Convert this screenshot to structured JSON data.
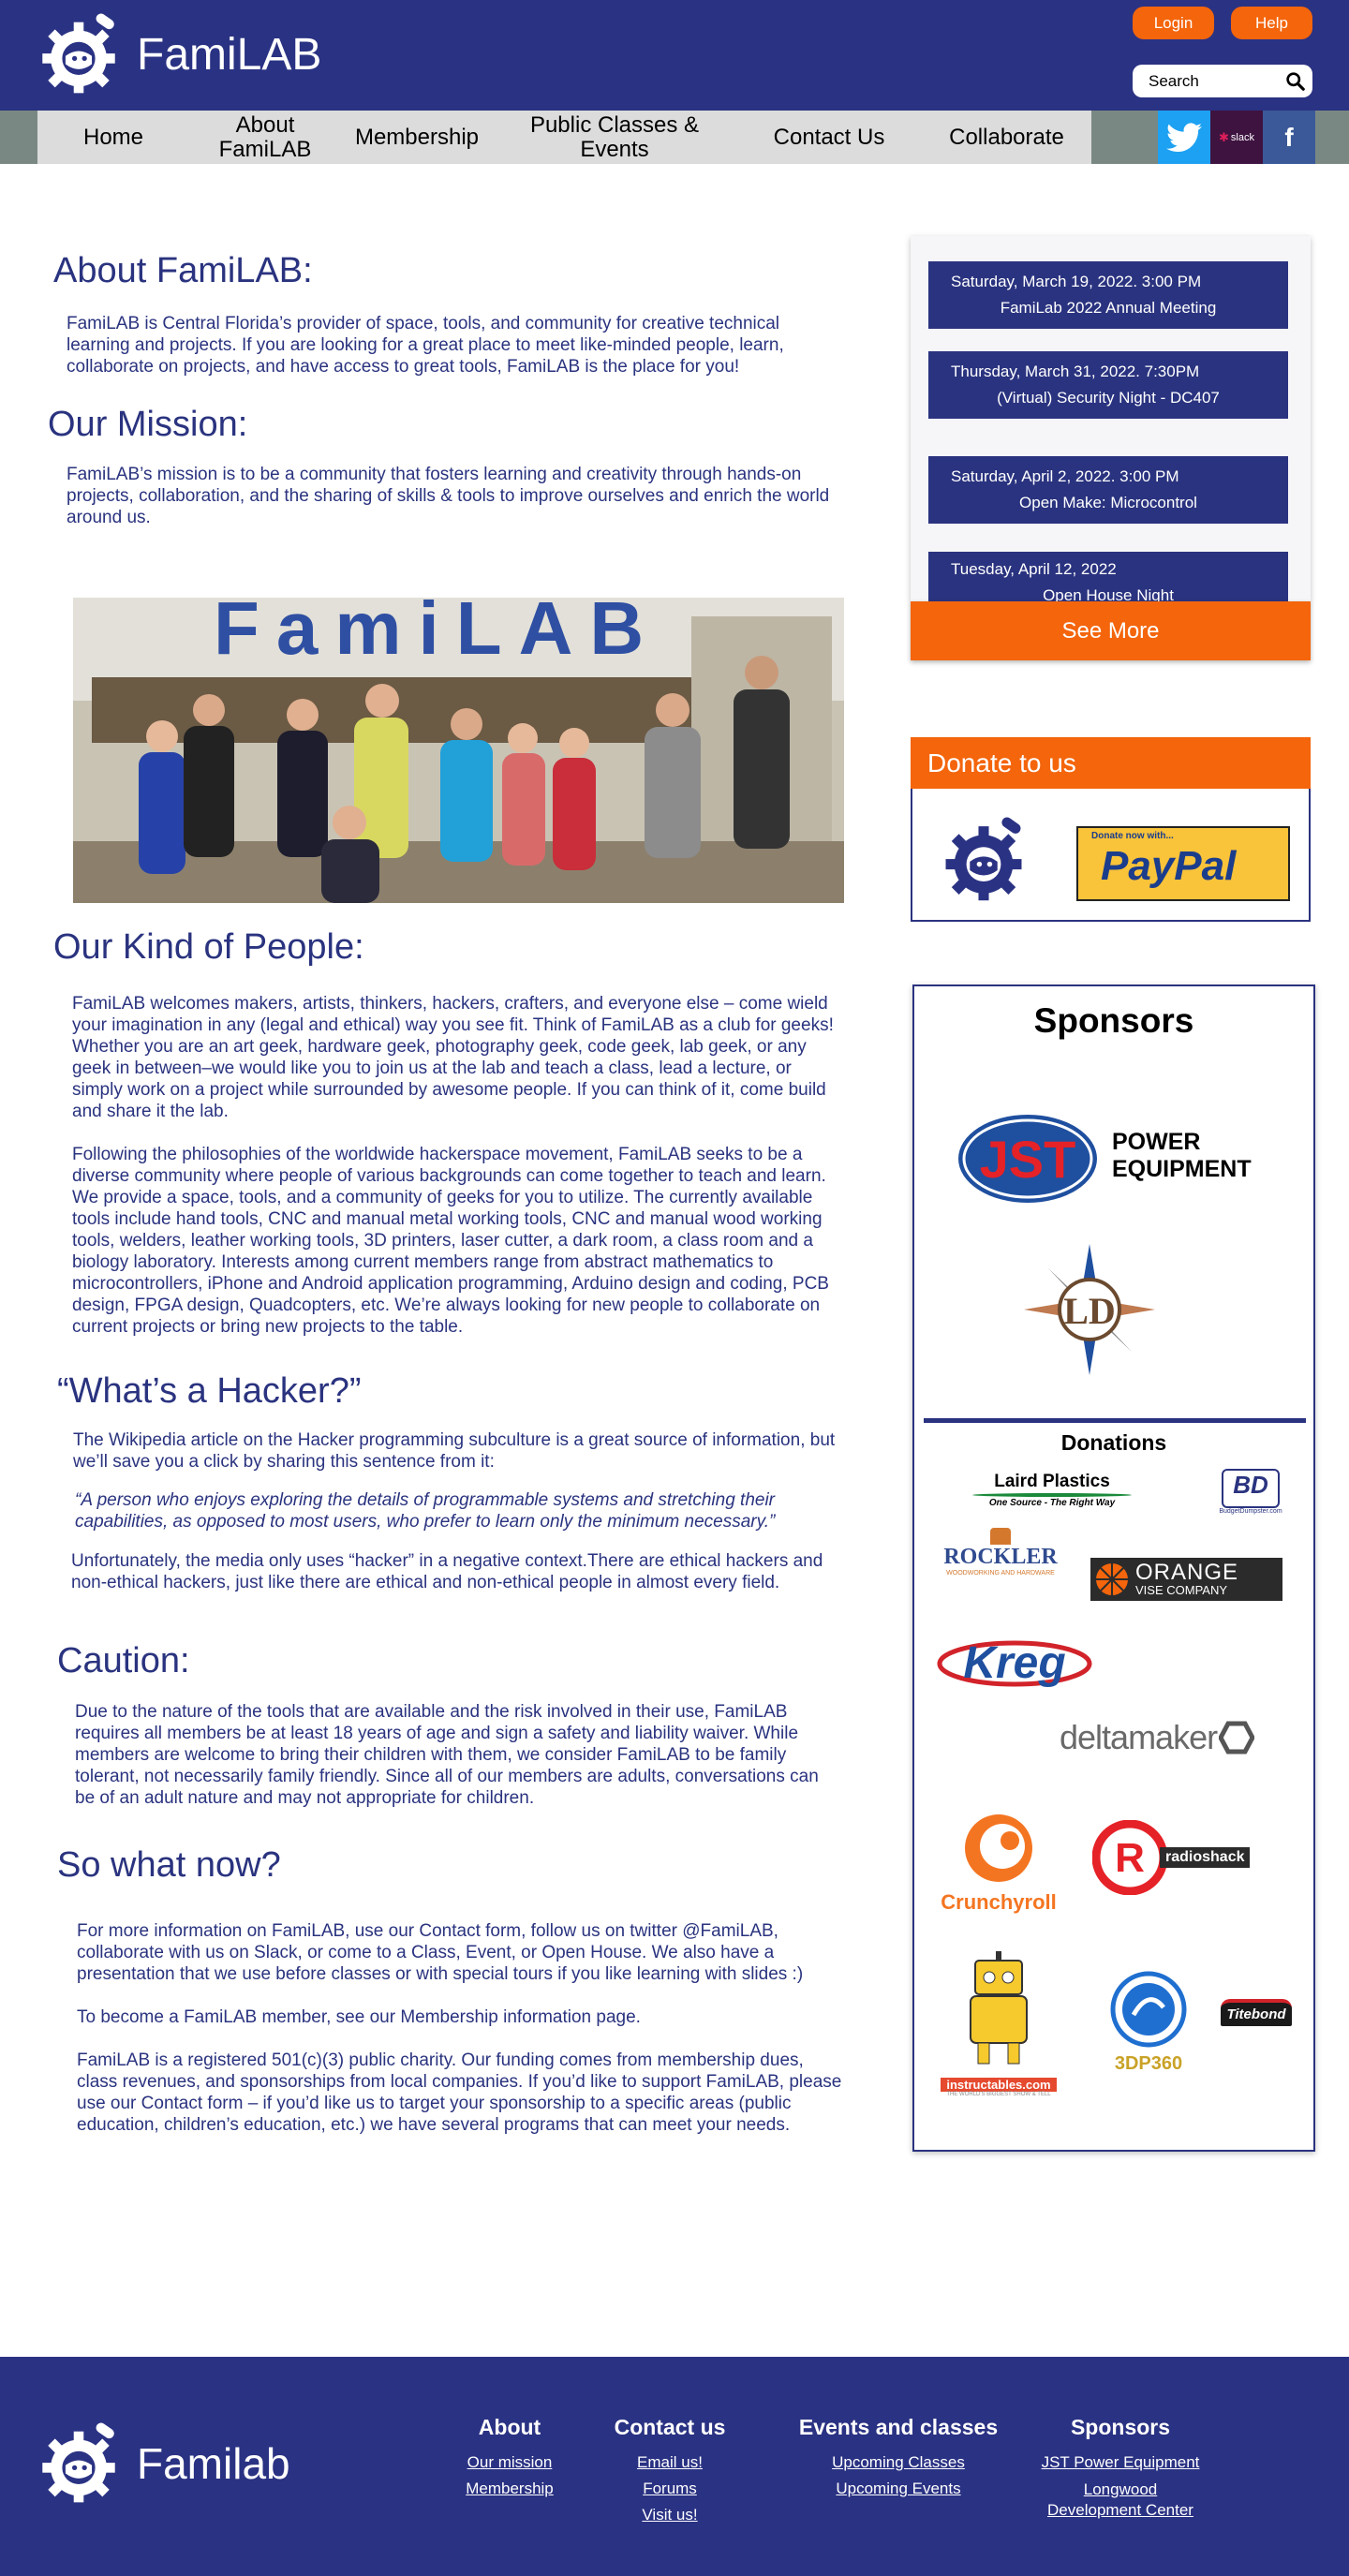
{
  "header": {
    "logo_text": "FamiLAB",
    "login_label": "Login",
    "help_label": "Help",
    "search_placeholder": "Search"
  },
  "nav": {
    "items": [
      "Home",
      "About FamiLAB",
      "Membership",
      "Public Classes & Events",
      "Contact Us",
      "Collaborate"
    ],
    "social": [
      "twitter-icon",
      "slack-icon",
      "facebook-icon"
    ],
    "slack_label": "slack"
  },
  "about": {
    "title": "About FamiLAB:",
    "text": "FamiLAB is Central Florida’s provider of space, tools, and community for creative technical learning and projects. If you are looking for a great place to meet like-minded people, learn, collaborate on projects, and have access to great tools, FamiLAB is the place for you!"
  },
  "mission": {
    "title": "Our Mission:",
    "text": "FamiLAB’s mission is to be a community that fosters learning and creativity through hands-on projects, collaboration, and the sharing of skills & tools to improve ourselves and enrich the world around us."
  },
  "photo": {
    "sign_text": "FamiLAB"
  },
  "people": {
    "title": "Our Kind of People:",
    "p1": "FamiLAB welcomes makers, artists, thinkers, hackers, crafters, and everyone else – come wield your imagination in any (legal and ethical) way you see fit. Think of FamiLAB as a club for geeks!  Whether you are an art geek, hardware geek, photography geek, code geek, lab geek, or any geek in between–we would like you to join us at the lab and teach a class, lead a lecture, or simply work on a project while surrounded by awesome people. If you can think of it, come build and share it the lab.",
    "p2": "Following the philosophies of the worldwide hackerspace movement, FamiLAB seeks to be a diverse community where people of various backgrounds can come together to teach and learn. We provide a space, tools, and a community of geeks for you to utilize. The currently available tools include hand tools, CNC and manual metal working tools, CNC and manual wood working tools, welders, leather working tools, 3D printers, laser cutter, a dark room, a class room and a biology laboratory. Interests among current members range from abstract mathematics to microcontrollers, iPhone and Android application programming, Arduino design and coding, PCB design, FPGA design, Quadcopters, etc.  We’re always looking for new people to collaborate on current projects or bring new projects to the table."
  },
  "hacker": {
    "title": "“What’s a Hacker?”",
    "p1": "The Wikipedia article on the Hacker programming subculture is a great source of information, but we’ll save you a click by sharing this sentence from it:",
    "quote": "“A person who enjoys exploring the details of programmable systems and stretching their capabilities, as opposed to most users, who prefer to learn only the minimum necessary.”",
    "p2": "Unfortunately, the media only uses “hacker” in a negative context.There are ethical hackers and non-ethical hackers, just like there are ethical and non-ethical people in almost every field."
  },
  "caution": {
    "title": "Caution:",
    "text": "Due to the nature of the tools that are available and the risk involved in their use, FamiLAB requires all members be at least 18 years of age and sign a safety and liability waiver. While members are welcome to bring their children with them, we consider FamiLAB to be family tolerant, not necessarily family friendly. Since all of our members are adults, conversations can be of an adult nature and may not appropriate for children."
  },
  "whatnow": {
    "title": "So what now?",
    "p1": "For more information on FamiLAB, use our Contact form, follow us on twitter @FamiLAB, collaborate with us on Slack, or come to a Class, Event, or Open House. We also have a presentation that we use before classes or with special tours if you like learning with slides :)",
    "p2": "To become a FamiLAB member, see our Membership information page.",
    "p3": "FamiLAB is a registered 501(c)(3) public charity. Our funding comes from membership dues, class revenues, and sponsorships from local companies. If you’d like to support FamiLAB, please use our Contact form – if you’d like us to target your sponsorship to a specific areas (public education, children’s education, etc.) we have several programs that can meet your needs."
  },
  "events": [
    {
      "date": "Saturday, March 19, 2022. 3:00 PM",
      "title": "FamiLab 2022 Annual Meeting"
    },
    {
      "date": "Thursday, March 31, 2022. 7:30PM",
      "title": "(Virtual) Security Night - DC407"
    },
    {
      "date": "Saturday, April 2, 2022. 3:00 PM",
      "title": "Open Make: Microcontrol"
    },
    {
      "date": "Tuesday, April 12, 2022",
      "title": "Open House Night"
    }
  ],
  "see_more_label": "See More",
  "donate": {
    "title": "Donate to us",
    "paypal_small": "Donate now with...",
    "paypal_big": "PayPal"
  },
  "sponsors": {
    "title": "Sponsors",
    "jst_letters": "JST",
    "jst_line1": "POWER",
    "jst_line2": "EQUIPMENT",
    "ldc_letters": "LD",
    "donations_title": "Donations",
    "laird_name": "Laird Plastics",
    "laird_tagline": "One Source - The Right Way",
    "bd_letters": "BD",
    "bd_name": "BudgetDumpster.com",
    "rockler_name": "ROCKLER",
    "rockler_tagline": "WOODWORKING AND HARDWARE",
    "orange_line1": "ORANGE",
    "orange_line2": "VISE COMPANY",
    "kreg_name": "Kreg",
    "deltamaker_name": "deltamaker",
    "crunchyroll_name": "Crunchyroll",
    "radioshack_name": "radioshack",
    "instructables_name": "instructables.com",
    "instructables_tagline": "THE WORLD'S BIGGEST SHOW & TELL",
    "threedp_name": "3DP360",
    "titebond_name": "Titebond"
  },
  "footer": {
    "logo_text": "Familab",
    "cols": [
      {
        "heading": "About",
        "links": [
          "Our mission",
          "Membership"
        ]
      },
      {
        "heading": "Contact us",
        "links": [
          "Email us!",
          "Forums",
          "Visit us!"
        ]
      },
      {
        "heading": "Events and classes",
        "links": [
          "Upcoming Classes",
          "Upcoming Events"
        ]
      },
      {
        "heading": "Sponsors",
        "links": [
          "JST Power Equipment",
          "Longwood Development Center"
        ]
      }
    ]
  },
  "colors": {
    "brand_blue": "#2a3283",
    "accent_orange": "#f4650c",
    "nav_gray": "#dcdcdc"
  }
}
